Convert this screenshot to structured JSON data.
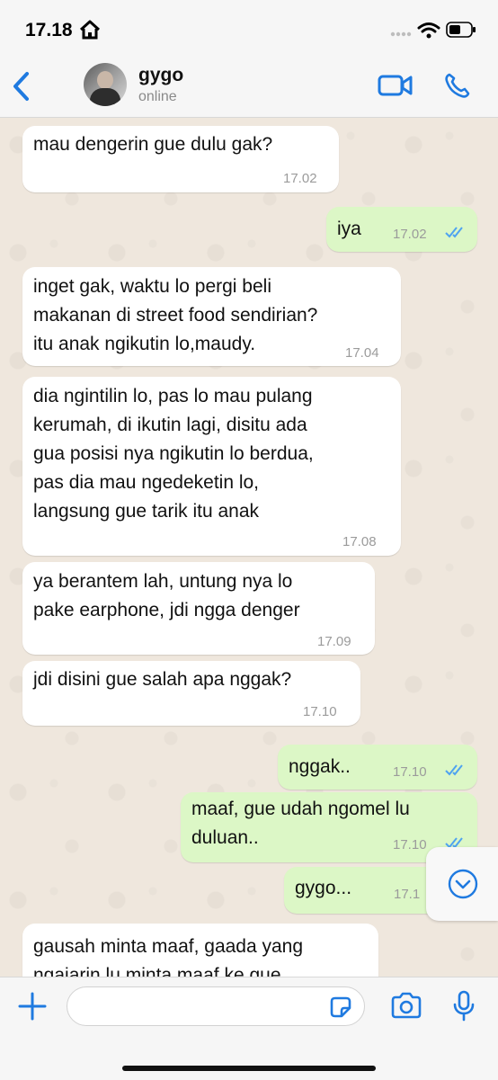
{
  "status_bar": {
    "time": "17.18"
  },
  "header": {
    "contact_name": "gygo",
    "contact_status": "online"
  },
  "messages": [
    {
      "direction": "incoming",
      "text": "mau dengerin gue dulu gak?",
      "time": "17.02"
    },
    {
      "direction": "outgoing",
      "text": "iya",
      "time": "17.02",
      "read": true
    },
    {
      "direction": "incoming",
      "text": "inget gak, waktu lo pergi beli\nmakanan di street food sendirian?\nitu anak ngikutin lo,maudy.",
      "time": "17.04"
    },
    {
      "direction": "incoming",
      "text": "dia ngintilin lo, pas lo mau pulang\nkerumah, di ikutin lagi, disitu ada\ngua posisi nya ngikutin lo berdua,\npas dia mau ngedeketin lo,\nlangsung gue tarik itu anak",
      "time": "17.08"
    },
    {
      "direction": "incoming",
      "text": "ya berantem lah, untung nya lo\npake earphone, jdi ngga denger",
      "time": "17.09"
    },
    {
      "direction": "incoming",
      "text": "jdi disini gue salah apa nggak?",
      "time": "17.10"
    },
    {
      "direction": "outgoing",
      "text": "nggak..",
      "time": "17.10",
      "read": true
    },
    {
      "direction": "outgoing",
      "text": "maaf, gue udah ngomel lu\nduluan..",
      "time": "17.10",
      "read": true
    },
    {
      "direction": "outgoing",
      "text": "gygo...",
      "time": "17.1",
      "read": true
    },
    {
      "direction": "incoming",
      "text": "gausah minta maaf, gaada yang\nngajarin lu minta maaf ke gue",
      "time": ""
    }
  ],
  "input": {
    "placeholder": ""
  },
  "icons": {
    "back": "chevron-left-icon",
    "video": "video-camera-icon",
    "call": "phone-icon",
    "plus": "plus-icon",
    "sticker": "sticker-icon",
    "camera": "camera-icon",
    "mic": "microphone-icon",
    "scroll_down": "chevron-down-circle-icon",
    "read_receipt": "double-check-icon"
  },
  "colors": {
    "accent": "#1f7ae0",
    "incoming_bubble": "#ffffff",
    "outgoing_bubble": "#dcf7c6",
    "chat_background": "#efe7dd",
    "read_tick": "#4fa3f0",
    "timestamp": "#9b9b9b"
  }
}
